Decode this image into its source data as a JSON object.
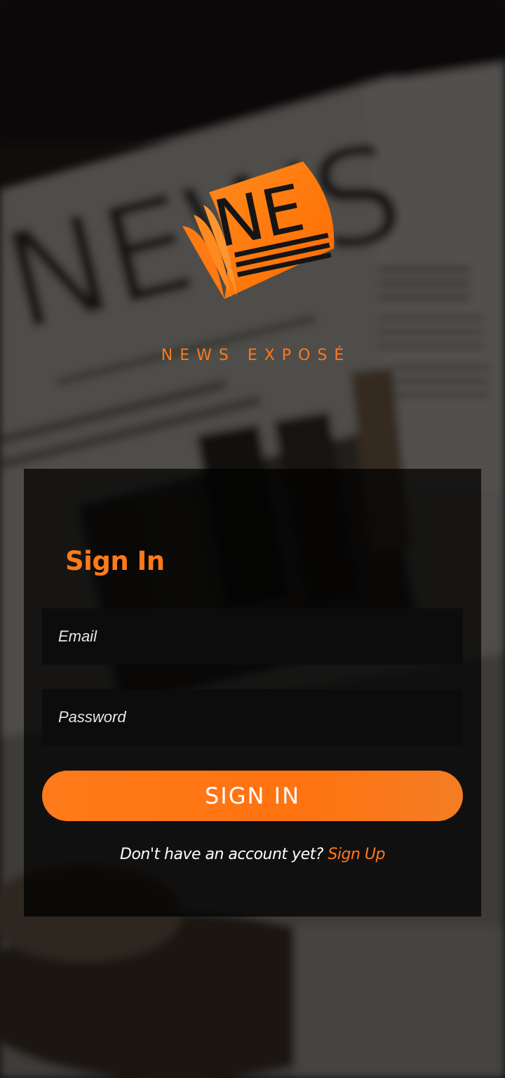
{
  "brand": {
    "logo_text": "NE",
    "name": "NEWS EXPOSÉ",
    "accent_color": "#ff7a1a"
  },
  "signin": {
    "title": "Sign In",
    "email_placeholder": "Email",
    "password_placeholder": "Password",
    "button_label": "SIGN IN",
    "no_account_text": "Don't have an account yet?",
    "signup_link_label": "Sign Up"
  },
  "background": {
    "icon": "newspaper-photo-background"
  }
}
